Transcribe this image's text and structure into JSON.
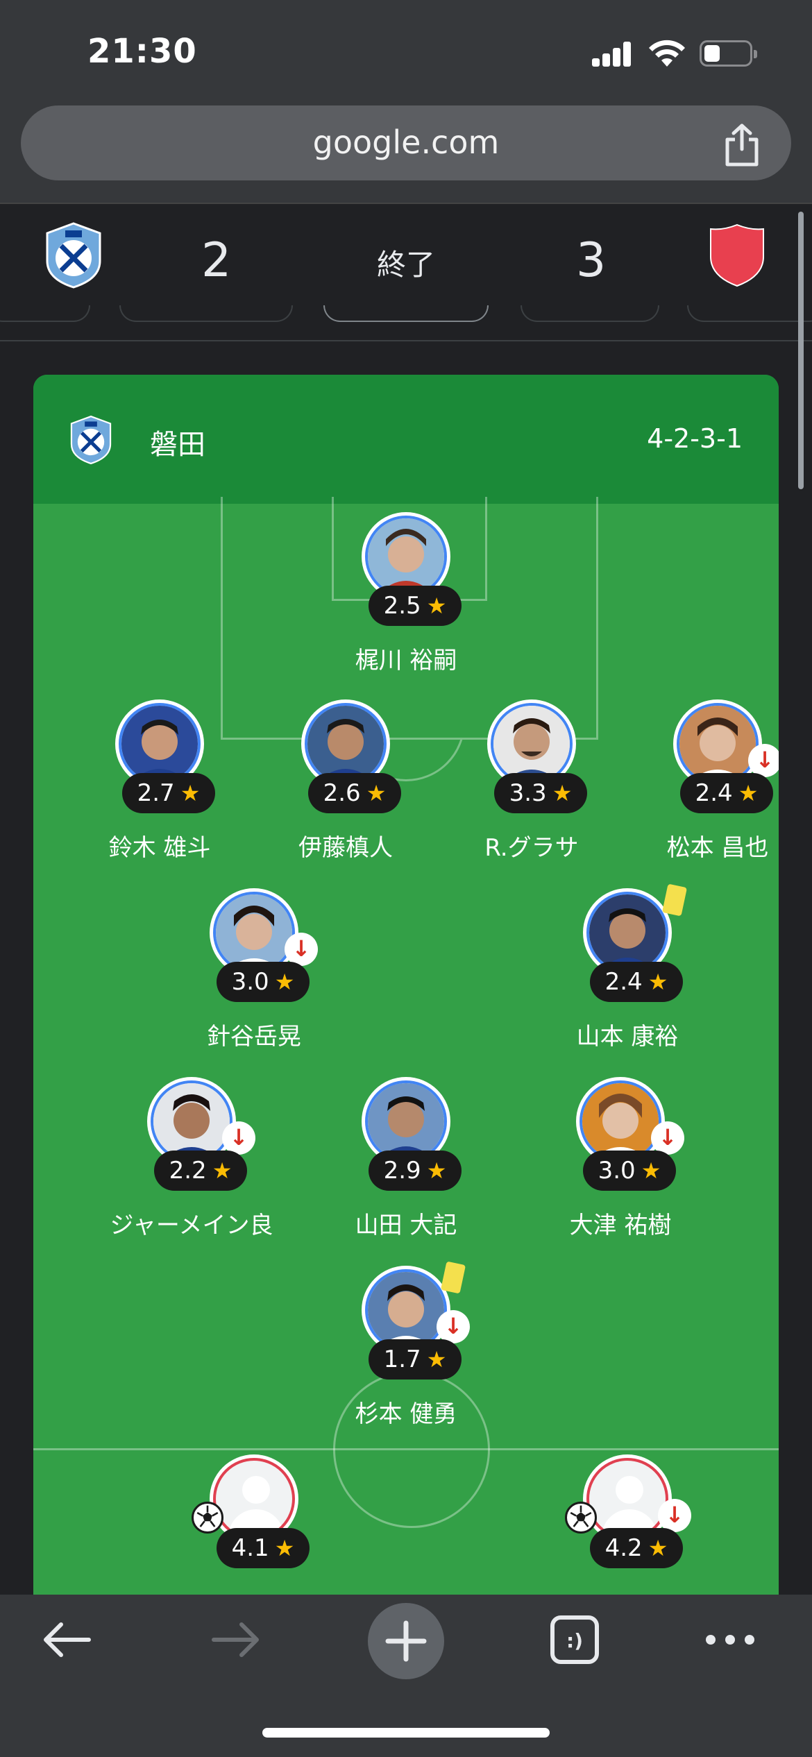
{
  "status_bar": {
    "time": "21:30"
  },
  "browser": {
    "url": "google.com"
  },
  "match": {
    "home_score": "2",
    "away_score": "3",
    "status": "終了"
  },
  "lineup": {
    "team_name": "磐田",
    "formation": "4-2-3-1",
    "players": [
      {
        "name": "梶川 裕嗣",
        "rating": "2.5",
        "sub": false,
        "yellow": false
      },
      {
        "name": "鈴木 雄斗",
        "rating": "2.7",
        "sub": false,
        "yellow": false
      },
      {
        "name": "伊藤槙人",
        "rating": "2.6",
        "sub": false,
        "yellow": false
      },
      {
        "name": "R.グラサ",
        "rating": "3.3",
        "sub": false,
        "yellow": false
      },
      {
        "name": "松本 昌也",
        "rating": "2.4",
        "sub": true,
        "yellow": false
      },
      {
        "name": "針谷岳晃",
        "rating": "3.0",
        "sub": true,
        "yellow": false
      },
      {
        "name": "山本 康裕",
        "rating": "2.4",
        "sub": false,
        "yellow": true
      },
      {
        "name": "ジャーメイン良",
        "rating": "2.2",
        "sub": true,
        "yellow": false
      },
      {
        "name": "山田 大記",
        "rating": "2.9",
        "sub": false,
        "yellow": false
      },
      {
        "name": "大津 祐樹",
        "rating": "3.0",
        "sub": true,
        "yellow": false
      },
      {
        "name": "杉本 健勇",
        "rating": "1.7",
        "sub": true,
        "yellow": true
      }
    ],
    "opponents": [
      {
        "rating": "4.1",
        "goal": true,
        "sub": false
      },
      {
        "rating": "4.2",
        "goal": true,
        "sub": true
      }
    ]
  },
  "icons": {
    "share": "share-icon",
    "back": "back-arrow-icon",
    "forward": "forward-arrow-icon",
    "new_tab": "plus-icon",
    "tabs": "tabs-icon",
    "more": "more-icon"
  },
  "colors": {
    "pitch": "#33a047",
    "header": "#1b8a38",
    "home_ring": "#4285f4",
    "away_ring": "#e04050",
    "star": "#fbbc04"
  }
}
